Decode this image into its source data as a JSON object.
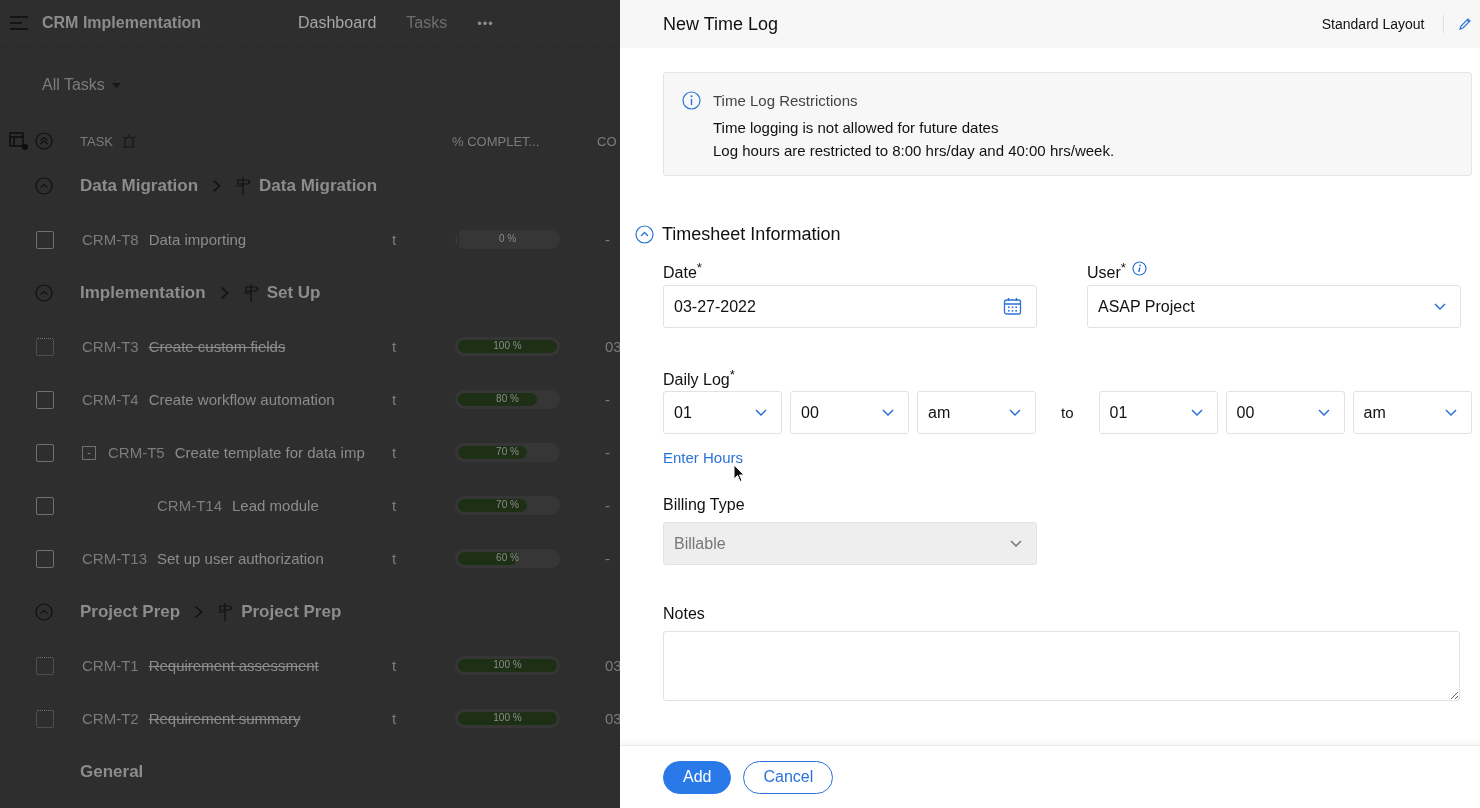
{
  "app": {
    "title": "CRM Implementation",
    "nav": [
      {
        "label": "Dashboard",
        "selected": true
      },
      {
        "label": "Tasks",
        "selected": false
      }
    ],
    "more": "•••",
    "view": "All Tasks",
    "columns": [
      "TASK",
      "% COMPLET...",
      "CO"
    ],
    "groups": [
      {
        "kind": "milestone",
        "name": "Data Migration",
        "tasklist": "Data Migration",
        "expanded": true,
        "tasks": [
          {
            "id": "CRM-T8",
            "name": "Data importing",
            "column_3": "t",
            "level": 0,
            "percent": "0 %",
            "column_5": "-",
            "completed": false,
            "checked": false
          }
        ]
      },
      {
        "kind": "milestone",
        "name": "Implementation",
        "tasklist": "Set Up",
        "expanded": true,
        "tasks": [
          {
            "id": "CRM-T3",
            "name": "Create custom fields",
            "column_3": "t",
            "level": 1,
            "percent": "100 %",
            "column_5": "03",
            "completed": true,
            "checked": false
          },
          {
            "id": "CRM-T4",
            "name": "Create workflow automation",
            "column_3": "t",
            "level": 0.8,
            "percent": "80 %",
            "column_5": "-",
            "completed": false,
            "checked": false
          },
          {
            "id": "CRM-T5",
            "name": "Create template for data imp",
            "column_3": "t",
            "level": 0.7,
            "percent": "70 %",
            "column_5": "-",
            "completed": false,
            "checked": false,
            "toggle": "-",
            "children": [
              {
                "id": "CRM-T14",
                "name": "Lead module",
                "column_3": "t",
                "level": 0.7,
                "percent": "70 %",
                "column_5": "-",
                "completed": false,
                "checked": false
              }
            ]
          },
          {
            "id": "CRM-T13",
            "name": "Set up user authorization",
            "column_3": "t",
            "level": 0.6,
            "percent": "60 %",
            "column_5": "-",
            "completed": false,
            "checked": false
          }
        ]
      },
      {
        "kind": "milestone",
        "name": "Project Prep",
        "tasklist": "Project Prep",
        "expanded": true,
        "tasks": [
          {
            "id": "CRM-T1",
            "name": "Requirement assessment",
            "column_3": "t",
            "level": 1,
            "percent": "100 %",
            "column_5": "03",
            "completed": true,
            "checked": false
          },
          {
            "id": "CRM-T2",
            "name": "Requirement summary",
            "column_3": "t",
            "level": 1,
            "percent": "100 %",
            "column_5": "03",
            "completed": true,
            "checked": false
          }
        ]
      },
      {
        "kind": "general",
        "name": "General"
      }
    ]
  },
  "panel": {
    "title": "New Time Log",
    "layout": "Standard Layout",
    "notice": {
      "title": "Time Log Restrictions",
      "lines": [
        "Time logging is not allowed for future dates",
        "Log hours are restricted to 8:00 hrs/day and 40:00 hrs/week."
      ]
    },
    "section": {
      "title": "Timesheet Information",
      "expanded": true
    },
    "date": {
      "label": "Date$^{*}$",
      "value": "03-27-2022"
    },
    "user": {
      "label": "User$^{*}$",
      "value": "ASAP Project"
    },
    "daily_log": {
      "label": "Daily Log$^{*}$",
      "from": [
        "01",
        "00",
        "am"
      ],
      "separator": "to",
      "to": [
        "01",
        "00",
        "am"
      ]
    },
    "enter_hours": "Enter Hours",
    "billing": {
      "label": "Billing Type",
      "value": "Billable",
      "disabled": true
    },
    "notes": {
      "label": "Notes"
    },
    "buttons": [
      {
        "label": "Add",
        "primary": true
      },
      {
        "label": "Cancel",
        "primary": false
      }
    ]
  }
}
